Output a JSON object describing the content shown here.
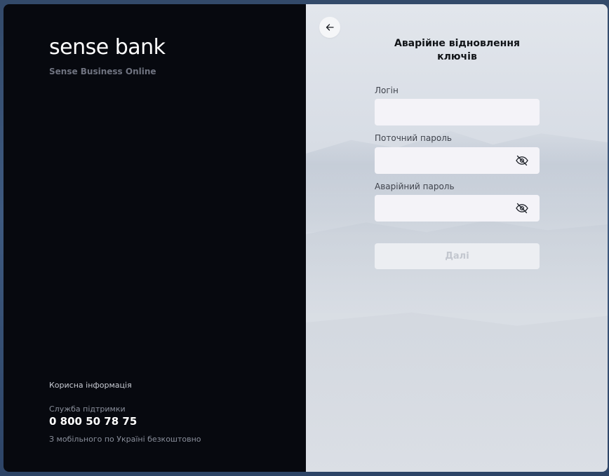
{
  "brand": {
    "logo_text": "sense bank",
    "subtitle": "Sense Business Online"
  },
  "info": {
    "useful_info": "Корисна інформація",
    "support_label": "Служба підтримки",
    "support_phone": "0 800 50 78 75",
    "support_note": "З мобільного по Україні безкоштовно"
  },
  "form": {
    "title": "Аварійне відновлення ключів",
    "login_label": "Логін",
    "login_value": "",
    "current_password_label": "Поточний пароль",
    "current_password_value": "",
    "emergency_password_label": "Аварійний пароль",
    "emergency_password_value": "",
    "next_label": "Далі",
    "next_enabled": false
  },
  "icons": {
    "back": "arrow-left-icon",
    "password_toggle": "eye-off-icon"
  },
  "colors": {
    "left_panel_bg": "#07090f",
    "input_bg": "#f4f3f8",
    "button_disabled_bg": "#eceef2",
    "button_disabled_text": "#c3c7cf"
  }
}
